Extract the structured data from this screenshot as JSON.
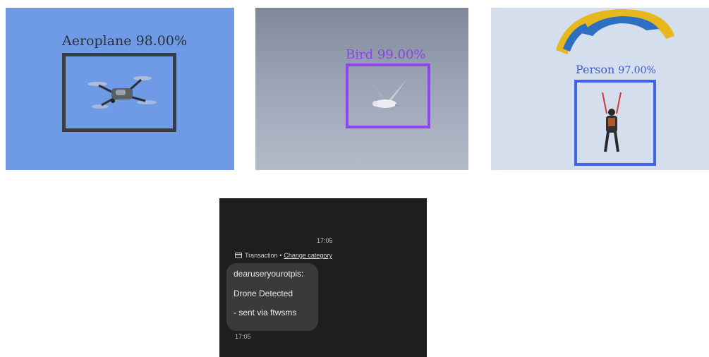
{
  "detections": [
    {
      "label": "Aeroplane",
      "confidence": "98.00%",
      "box_color": "#3a3d42",
      "label_color": "#2b2f36",
      "subject_icon": "drone-icon"
    },
    {
      "label": "Bird",
      "confidence": "99.00%",
      "box_color": "#8f46ee",
      "label_color": "#8b44e6",
      "subject_icon": "bird-icon"
    },
    {
      "label": "Person",
      "confidence": "97.00%",
      "box_color": "#3e63e8",
      "label_color": "#3a5cd6",
      "subject_icon": "paraglider-icon"
    }
  ],
  "sms": {
    "time_top": "17:05",
    "category_prefix": "Transaction •",
    "category_link": "Change category",
    "lines": [
      "dearuseryourotpis:",
      "Drone Detected",
      "- sent via ftwsms"
    ],
    "time_bottom": "17:05"
  }
}
